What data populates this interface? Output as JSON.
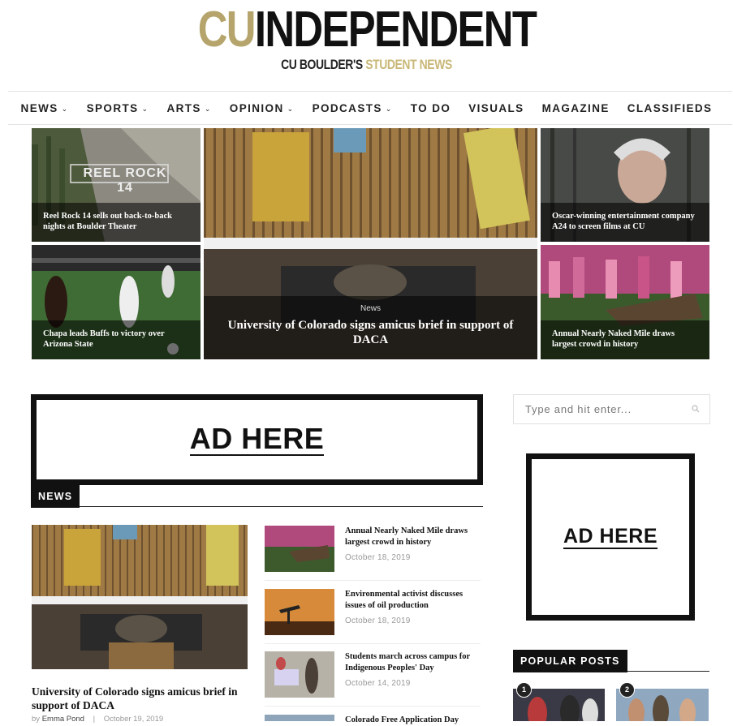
{
  "header": {
    "logo_cu": "CU",
    "logo_rest": "INDEPENDENT",
    "tagline_prefix": "CU BOULDER'S",
    "tagline_suffix": "STUDENT NEWS"
  },
  "nav": {
    "items": [
      {
        "label": "NEWS",
        "has_dropdown": true
      },
      {
        "label": "SPORTS",
        "has_dropdown": true
      },
      {
        "label": "ARTS",
        "has_dropdown": true
      },
      {
        "label": "OPINION",
        "has_dropdown": true
      },
      {
        "label": "PODCASTS",
        "has_dropdown": true
      },
      {
        "label": "TO DO",
        "has_dropdown": false
      },
      {
        "label": "VISUALS",
        "has_dropdown": false
      },
      {
        "label": "MAGAZINE",
        "has_dropdown": false
      },
      {
        "label": "CLASSIFIEDS",
        "has_dropdown": false
      }
    ],
    "chevron": "⌄"
  },
  "featured": {
    "top_left": {
      "title": "Reel Rock 14 sells out back-to-back nights at Boulder Theater",
      "image_text": "REEL ROCK 14"
    },
    "bottom_left": {
      "title": "Chapa leads Buffs to victory over Arizona State"
    },
    "center": {
      "category": "News",
      "title": "University of Colorado signs amicus brief in support of DACA"
    },
    "top_right": {
      "title": "Oscar-winning entertainment company A24 to screen films at CU"
    },
    "bottom_right": {
      "title": "Annual Nearly Naked Mile draws largest crowd in history"
    }
  },
  "ads": {
    "main_label": "AD HERE",
    "side_label": "AD HERE"
  },
  "search": {
    "placeholder": "Type and hit enter..."
  },
  "news_section": {
    "label": "NEWS",
    "main_article": {
      "title": "University of Colorado signs amicus brief in support of DACA",
      "by": "by",
      "author": "Emma Pond",
      "date": "October 19, 2019"
    },
    "list": [
      {
        "title": "Annual Nearly Naked Mile draws largest crowd in history",
        "date": "October 18, 2019"
      },
      {
        "title": "Environmental activist discusses issues of oil production",
        "date": "October 18, 2019"
      },
      {
        "title": "Students march across campus for Indigenous Peoples' Day",
        "date": "October 14, 2019"
      },
      {
        "title": "Colorado Free Application Day",
        "date": ""
      }
    ]
  },
  "popular_posts": {
    "label": "POPULAR POSTS",
    "badges": [
      "1",
      "2"
    ]
  },
  "colors": {
    "gold": "#b5a46b",
    "black": "#111111",
    "caption_overlay": "rgba(0,0,0,0.55)"
  }
}
